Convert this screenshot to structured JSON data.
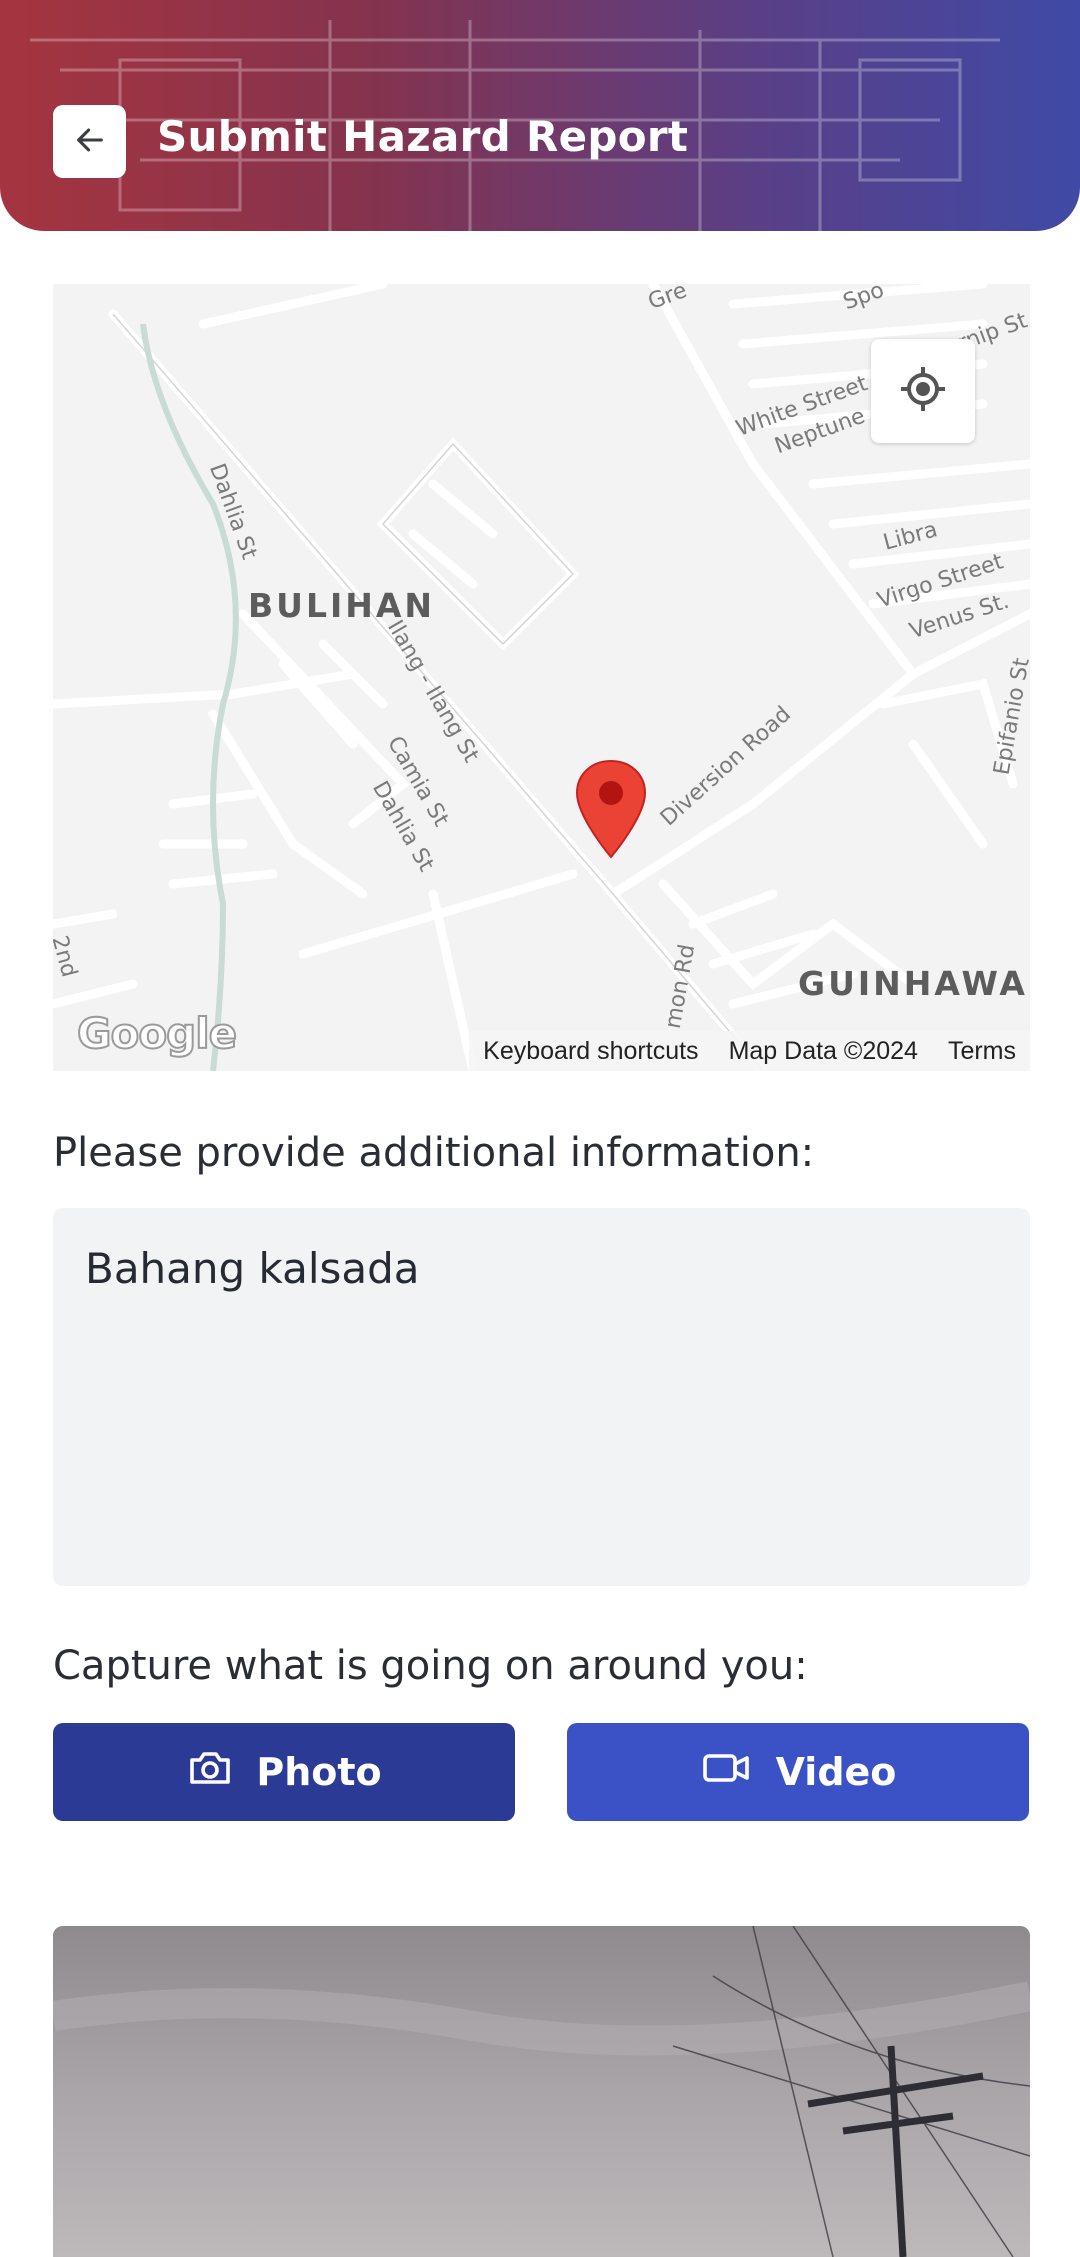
{
  "header": {
    "title": "Submit Hazard Report",
    "back_icon": "arrow-left-icon",
    "gradient_start": "#a5343f",
    "gradient_end": "#3f4aa6"
  },
  "map": {
    "districts": [
      "BULIHAN",
      "GUINHAWA"
    ],
    "streets": [
      "Dahlia St",
      "Ilang - Ilang St",
      "Camia St",
      "Dahlia St",
      "Diversion Road",
      "White Street",
      "Neptune",
      "Libra",
      "Virgo Street",
      "Venus St.",
      "Epifanio St",
      "Turnip St",
      "Spo",
      "Gre",
      "2nd",
      "mon Rd"
    ],
    "locate_icon": "my-location-icon",
    "pin_icon": "map-pin-icon",
    "logo_text": "Google",
    "attribution": {
      "shortcuts": "Keyboard shortcuts",
      "map_data": "Map Data ©2024",
      "terms": "Terms"
    }
  },
  "form": {
    "info_label": "Please provide additional information:",
    "info_value": "Bahang kalsada",
    "capture_label": "Capture what is going on around you:",
    "photo_label": "Photo",
    "video_label": "Video",
    "photo_icon": "camera-icon",
    "video_icon": "video-camera-icon"
  },
  "colors": {
    "photo_button": "#2b3a94",
    "video_button": "#3a52c6",
    "pin": "#ea4335"
  }
}
